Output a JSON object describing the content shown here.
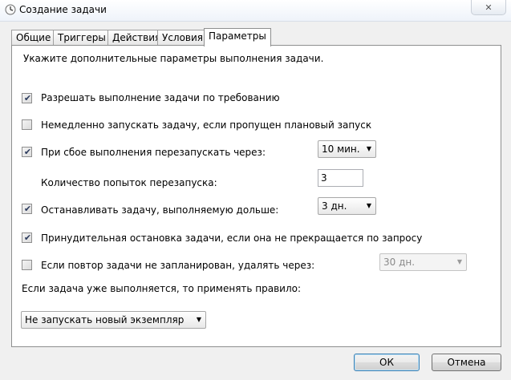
{
  "window": {
    "title": "Создание задачи",
    "close_glyph": "✕"
  },
  "tabs": [
    {
      "label": "Общие"
    },
    {
      "label": "Триггеры"
    },
    {
      "label": "Действия"
    },
    {
      "label": "Условия"
    },
    {
      "label": "Параметры",
      "active": true
    }
  ],
  "settings": {
    "intro": "Укажите дополнительные параметры выполнения задачи.",
    "allow_on_demand": {
      "label": "Разрешать выполнение задачи по требованию",
      "checked": true
    },
    "run_missed": {
      "label": "Немедленно запускать задачу, если пропущен плановый запуск",
      "checked": false
    },
    "restart_on_fail": {
      "label": "При сбое выполнения перезапускать через:",
      "checked": true,
      "value": "10 мин."
    },
    "restart_attempts": {
      "label": "Количество попыток перезапуска:",
      "value": "3"
    },
    "stop_if_longer": {
      "label": "Останавливать задачу, выполняемую дольше:",
      "checked": true,
      "value": "3 дн."
    },
    "force_stop": {
      "label": "Принудительная остановка задачи, если она не прекращается по запросу",
      "checked": true
    },
    "delete_if_not_scheduled": {
      "label": "Если повтор задачи не запланирован, удалять через:",
      "checked": false,
      "value": "30 дн.",
      "disabled": true
    },
    "rule_label": "Если задача уже выполняется, то применять правило:",
    "rule_value": "Не запускать новый экземпляр"
  },
  "buttons": {
    "ok": "ОК",
    "cancel": "Отмена"
  },
  "check_glyph": "✔",
  "dropdown_glyph": "▼"
}
